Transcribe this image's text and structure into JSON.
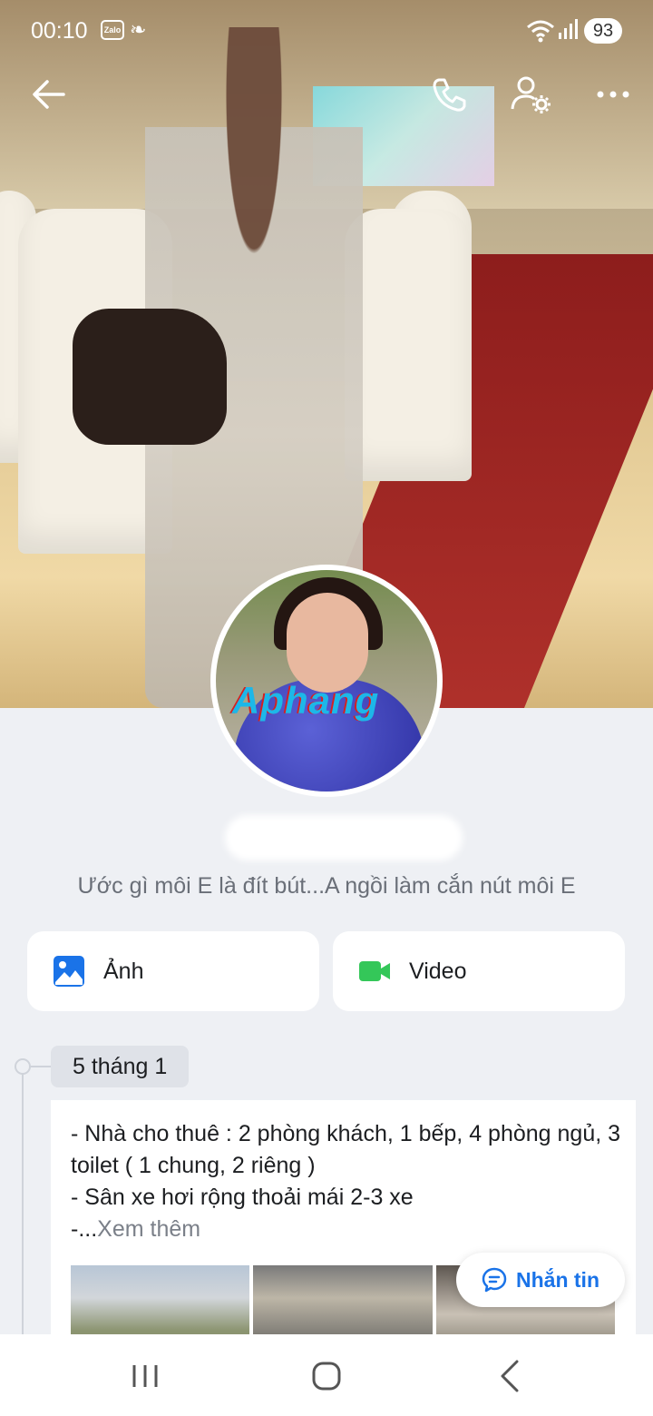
{
  "status_bar": {
    "time": "00:10",
    "app_badge": "Zalo",
    "battery": "93"
  },
  "profile": {
    "bio": "Ước gì môi E là đít bút...A ngồi làm cắn nút môi E",
    "avatar_watermark": "Aphang"
  },
  "actions": {
    "photos_label": "Ảnh",
    "video_label": "Video"
  },
  "timeline": {
    "date": "5 tháng 1",
    "post": {
      "line1": "- Nhà cho thuê : 2 phòng khách, 1 bếp, 4 phòng ngủ, 3 toilet ( 1 chung, 2 riêng )",
      "line2": "- Sân xe hơi rộng thoải mái 2-3 xe",
      "line3_prefix": "-...",
      "see_more": "Xem thêm"
    }
  },
  "message_button": {
    "label": "Nhắn tin"
  },
  "colors": {
    "accent_blue": "#1a73e8",
    "video_green": "#34c759",
    "background": "#eef0f4"
  },
  "icons": {
    "header": [
      "back-arrow-icon",
      "phone-icon",
      "profile-settings-icon",
      "more-icon"
    ],
    "nav": [
      "recent-apps-icon",
      "home-icon",
      "back-icon"
    ]
  }
}
